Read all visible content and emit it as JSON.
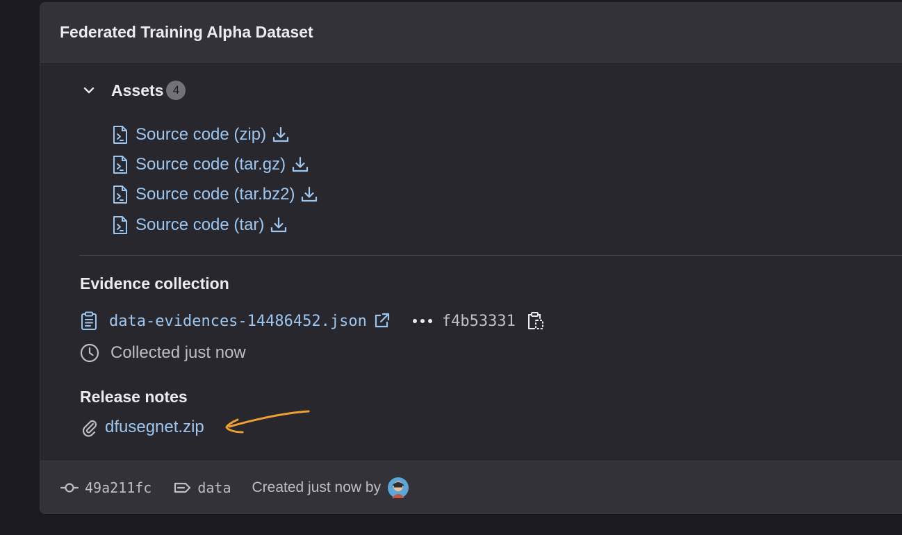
{
  "release": {
    "title": "Federated Training Alpha Dataset"
  },
  "assets": {
    "title": "Assets",
    "count": "4",
    "items": [
      {
        "label": "Source code (zip)"
      },
      {
        "label": "Source code (tar.gz)"
      },
      {
        "label": "Source code (tar.bz2)"
      },
      {
        "label": "Source code (tar)"
      }
    ]
  },
  "evidence": {
    "title": "Evidence collection",
    "file": "data-evidences-14486452.json",
    "sha": "f4b53331",
    "collected": "Collected just now"
  },
  "release_notes": {
    "title": "Release notes",
    "attachment": "dfusegnet.zip"
  },
  "footer": {
    "commit": "49a211fc",
    "tag": "data",
    "created": "Created just now by"
  },
  "colors": {
    "link": "#9dc7f1",
    "annotation_arrow": "#f0a030",
    "background": "#1b1a20",
    "card": "#28272d"
  }
}
